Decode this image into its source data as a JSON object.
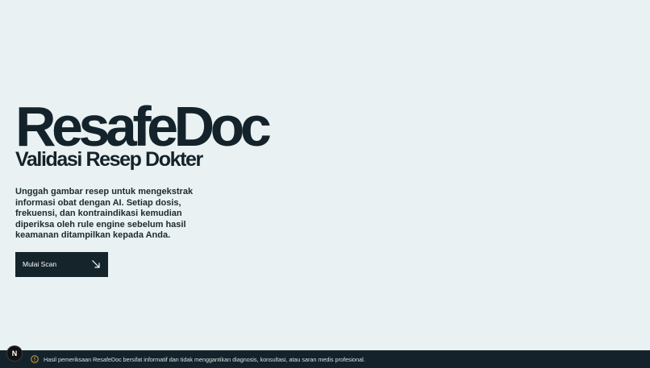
{
  "hero": {
    "brand": "ResafeDoc",
    "subtitle": "Validasi Resep Dokter",
    "description": "Unggah gambar resep untuk mengekstrak informasi obat dengan AI. Setiap dosis, frekuensi, dan kontraindikasi kemudian diperiksa oleh rule engine sebelum hasil keamanan ditampilkan kepada Anda.",
    "cta_label": "Mulai Scan",
    "cta_icon": "arrow-down-right-icon"
  },
  "footer": {
    "icon": "warning-circle-icon",
    "disclaimer": "Hasil pemeriksaan ResafeDoc bersifat informatif dan tidak menggantikan diagnosis, konsultasi, atau saran medis profesional."
  },
  "dev_badge": {
    "label": "N"
  },
  "colors": {
    "background": "#e9f1f2",
    "ink": "#14232b",
    "footer_bg": "#14232b",
    "warning": "#d8a23a"
  }
}
